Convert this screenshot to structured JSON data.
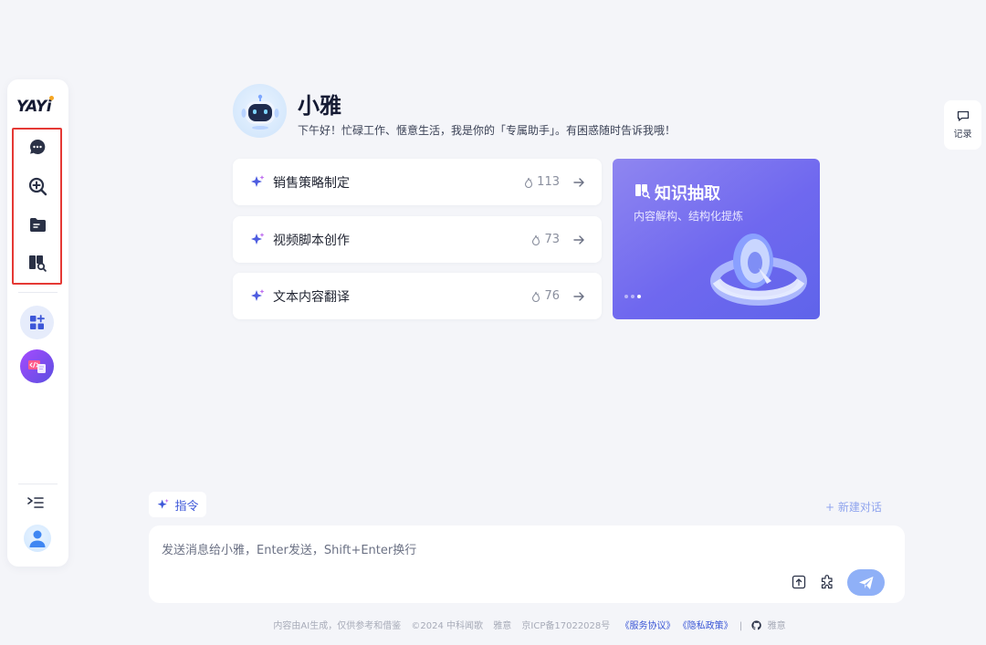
{
  "sidebar": {
    "logo": "YAYi",
    "nav": [
      {
        "icon": "chat-bubble-icon"
      },
      {
        "icon": "search-plus-icon"
      },
      {
        "icon": "folder-icon"
      },
      {
        "icon": "book-search-icon"
      }
    ],
    "apps": [
      {
        "icon": "apps-grid-icon"
      },
      {
        "icon": "code-app-icon"
      }
    ]
  },
  "assistant": {
    "name": "小雅",
    "greeting": "下午好！忙碌工作、惬意生活，我是你的「专属助手」。有困惑随时告诉我哦！"
  },
  "suggestions": [
    {
      "label": "销售策略制定",
      "count": "113"
    },
    {
      "label": "视频脚本创作",
      "count": "73"
    },
    {
      "label": "文本内容翻译",
      "count": "76"
    }
  ],
  "feature": {
    "title": "知识抽取",
    "subtitle": "内容解构、结构化提炼",
    "slide_index": 2,
    "slide_total": 3
  },
  "record": {
    "label": "记录"
  },
  "command": {
    "label": "指令"
  },
  "new_chat": {
    "label": "+ 新建对话"
  },
  "input": {
    "placeholder": "发送消息给小雅，Enter发送，Shift+Enter换行",
    "value": ""
  },
  "footer": {
    "disclaimer": "内容由AI生成，仅供参考和借鉴",
    "copyright": "©2024 中科闻歌",
    "brand": "雅意",
    "icp": "京ICP备17022028号",
    "terms": "《服务协议》",
    "privacy": "《隐私政策》",
    "github": "雅意"
  },
  "colors": {
    "accent": "#3d57d8",
    "background": "#f4f5f9",
    "highlight": "#e53935",
    "send": "#8fb0f7"
  }
}
